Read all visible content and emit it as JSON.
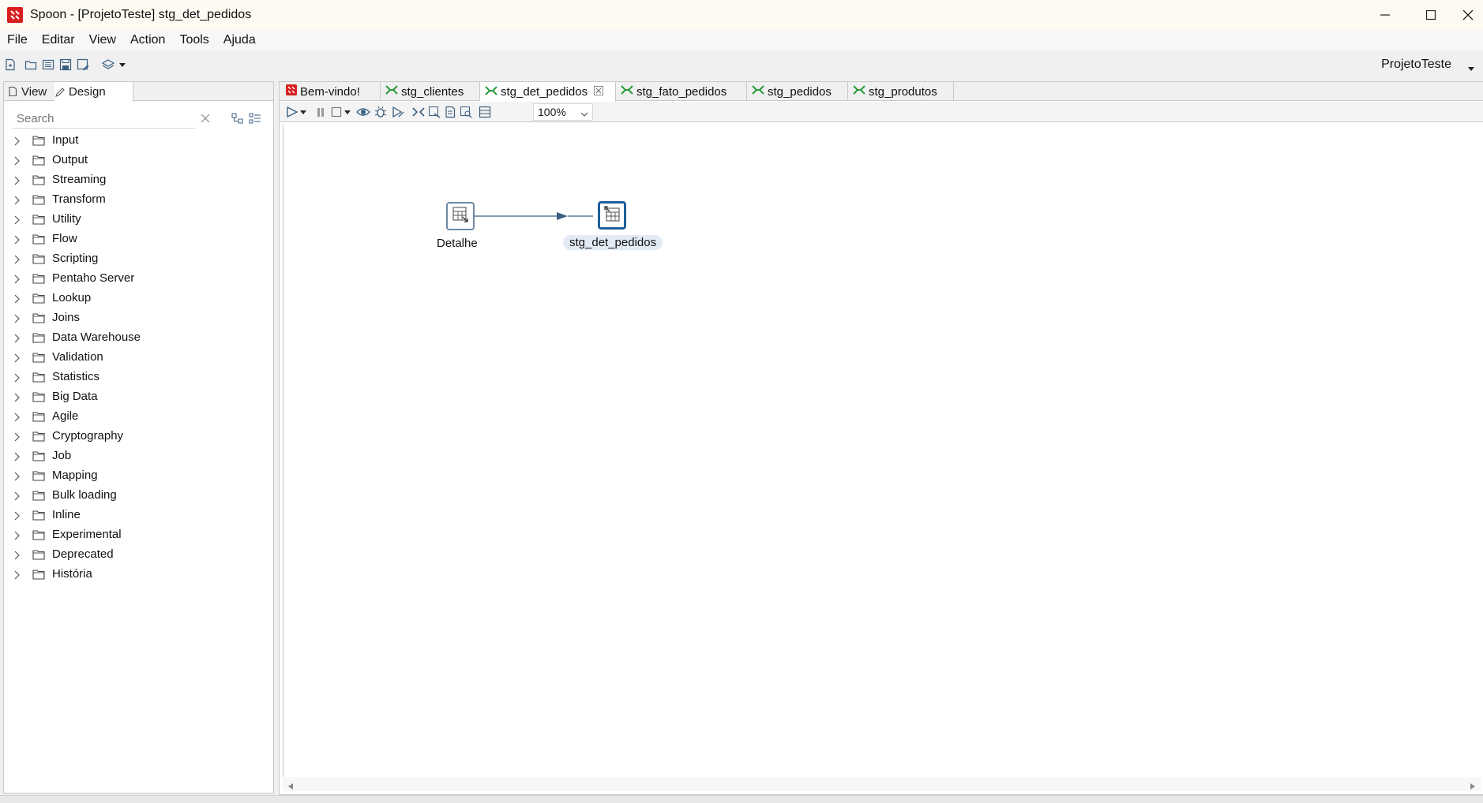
{
  "window": {
    "title": "Spoon - [ProjetoTeste] stg_det_pedidos"
  },
  "menu": [
    "File",
    "Editar",
    "View",
    "Action",
    "Tools",
    "Ajuda"
  ],
  "toolbar": {
    "perspective": "ProjetoTeste"
  },
  "left_panel": {
    "tabs": [
      "View",
      "Design"
    ],
    "search_placeholder": "Search",
    "categories": [
      "Input",
      "Output",
      "Streaming",
      "Transform",
      "Utility",
      "Flow",
      "Scripting",
      "Pentaho Server",
      "Lookup",
      "Joins",
      "Data Warehouse",
      "Validation",
      "Statistics",
      "Big Data",
      "Agile",
      "Cryptography",
      "Job",
      "Mapping",
      "Bulk loading",
      "Inline",
      "Experimental",
      "Deprecated",
      "História"
    ]
  },
  "editor": {
    "tabs": [
      {
        "label": "Bem-vindo!",
        "icon": "welcome-icon"
      },
      {
        "label": "stg_clientes",
        "icon": "transformation-icon"
      },
      {
        "label": "stg_det_pedidos",
        "icon": "transformation-icon",
        "active": true
      },
      {
        "label": "stg_fato_pedidos",
        "icon": "transformation-icon"
      },
      {
        "label": "stg_pedidos",
        "icon": "transformation-icon"
      },
      {
        "label": "stg_produtos",
        "icon": "transformation-icon"
      }
    ],
    "zoom": "100%"
  },
  "canvas": {
    "steps": [
      {
        "label": "Detalhe",
        "icon": "table-input-icon"
      },
      {
        "label": "stg_det_pedidos",
        "icon": "table-output-icon",
        "selected": true
      }
    ],
    "hops": [
      {
        "from": "Detalhe",
        "to": "stg_det_pedidos"
      }
    ]
  },
  "colors": {
    "accent": "#1f5f9a",
    "transformation_icon": "#2a9a3a",
    "app_icon": "#d81e1e"
  }
}
